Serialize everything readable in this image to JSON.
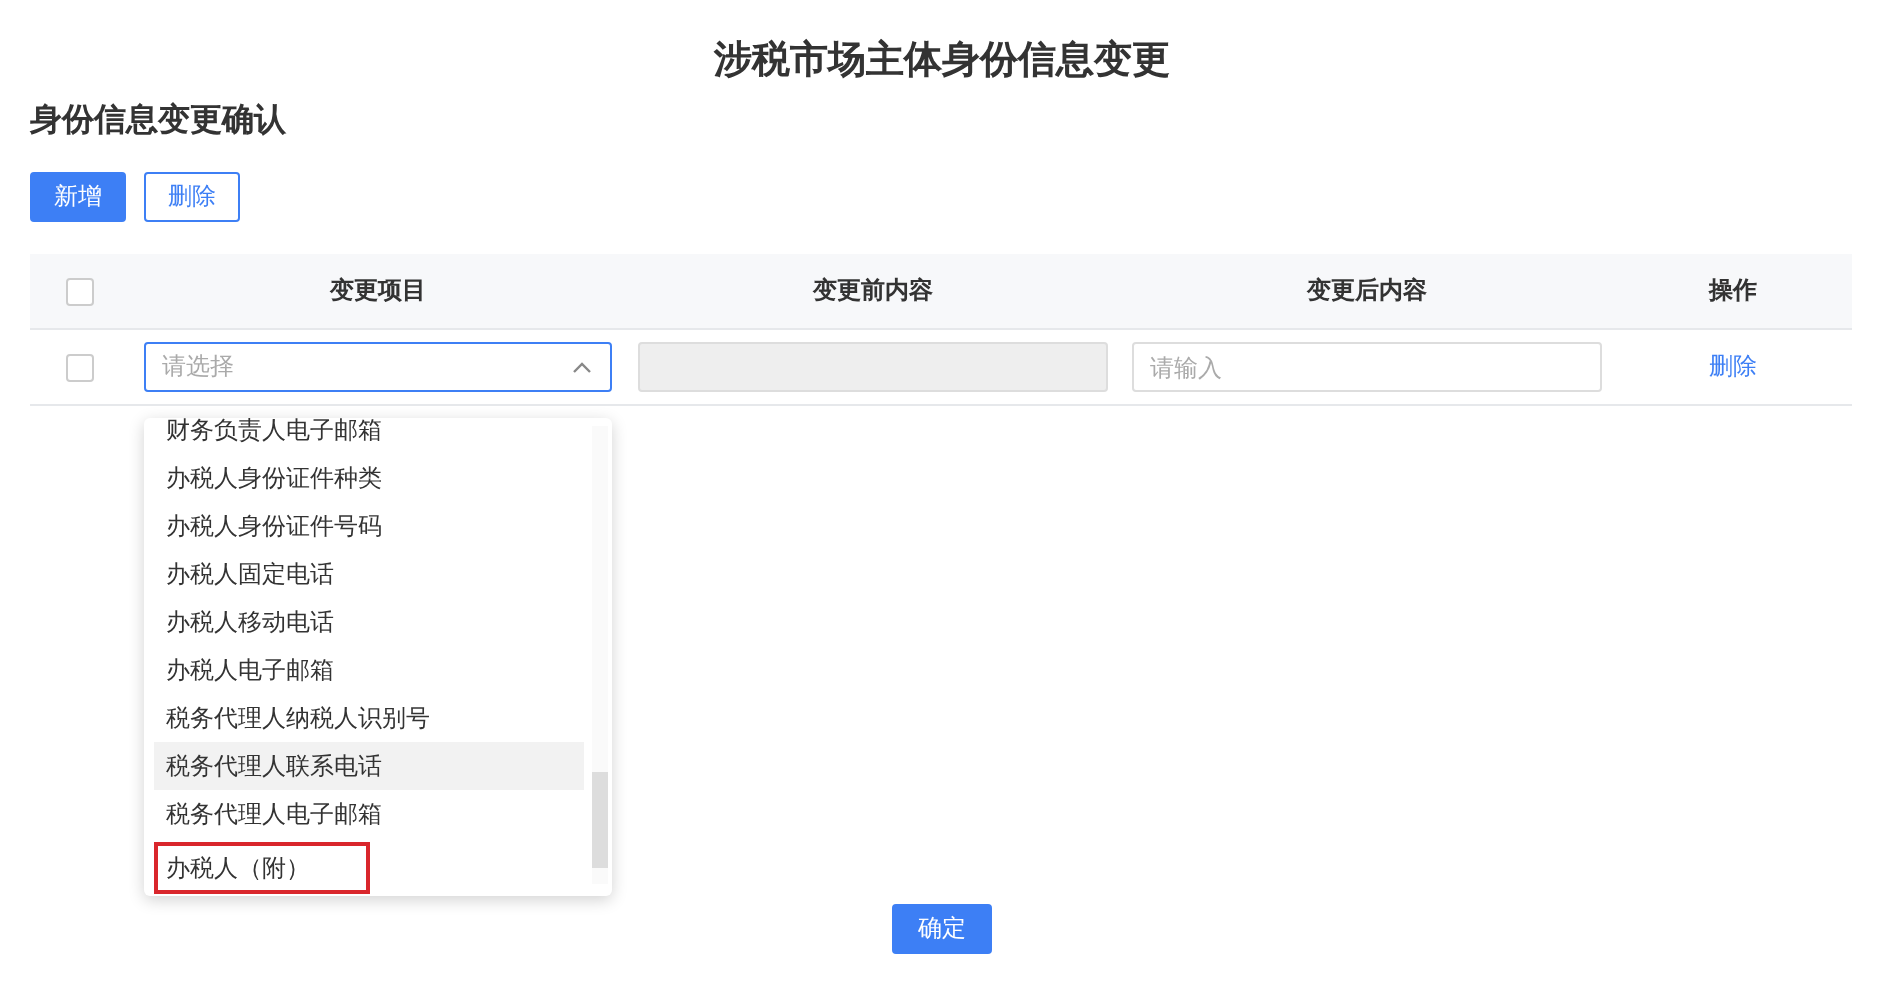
{
  "page_title": "涉税市场主体身份信息变更",
  "section_title": "身份信息变更确认",
  "toolbar": [
    {
      "label": "新增",
      "kind": "primary"
    },
    {
      "label": "删除",
      "kind": "outline"
    }
  ],
  "table": {
    "select_all_checked": false,
    "columns": [
      "变更项目",
      "变更前内容",
      "变更后内容",
      "操作"
    ],
    "rows": [
      {
        "checked": false,
        "item_placeholder": "请选择",
        "before_disabled": true,
        "after_placeholder": "请输入",
        "action": "删除"
      }
    ]
  },
  "dropdown": {
    "open": true,
    "options": [
      {
        "label": "财务负责人电子邮箱",
        "selected": false,
        "marked": false
      },
      {
        "label": "办税人身份证件种类",
        "selected": false,
        "marked": false
      },
      {
        "label": "办税人身份证件号码",
        "selected": false,
        "marked": false
      },
      {
        "label": "办税人固定电话",
        "selected": false,
        "marked": false
      },
      {
        "label": "办税人移动电话",
        "selected": false,
        "marked": false
      },
      {
        "label": "办税人电子邮箱",
        "selected": false,
        "marked": false
      },
      {
        "label": "税务代理人纳税人识别号",
        "selected": false,
        "marked": false
      },
      {
        "label": "税务代理人联系电话",
        "selected": true,
        "marked": false
      },
      {
        "label": "税务代理人电子邮箱",
        "selected": false,
        "marked": false
      },
      {
        "label": "办税人（附）",
        "selected": false,
        "marked": true
      }
    ]
  },
  "confirm_button": "确定"
}
